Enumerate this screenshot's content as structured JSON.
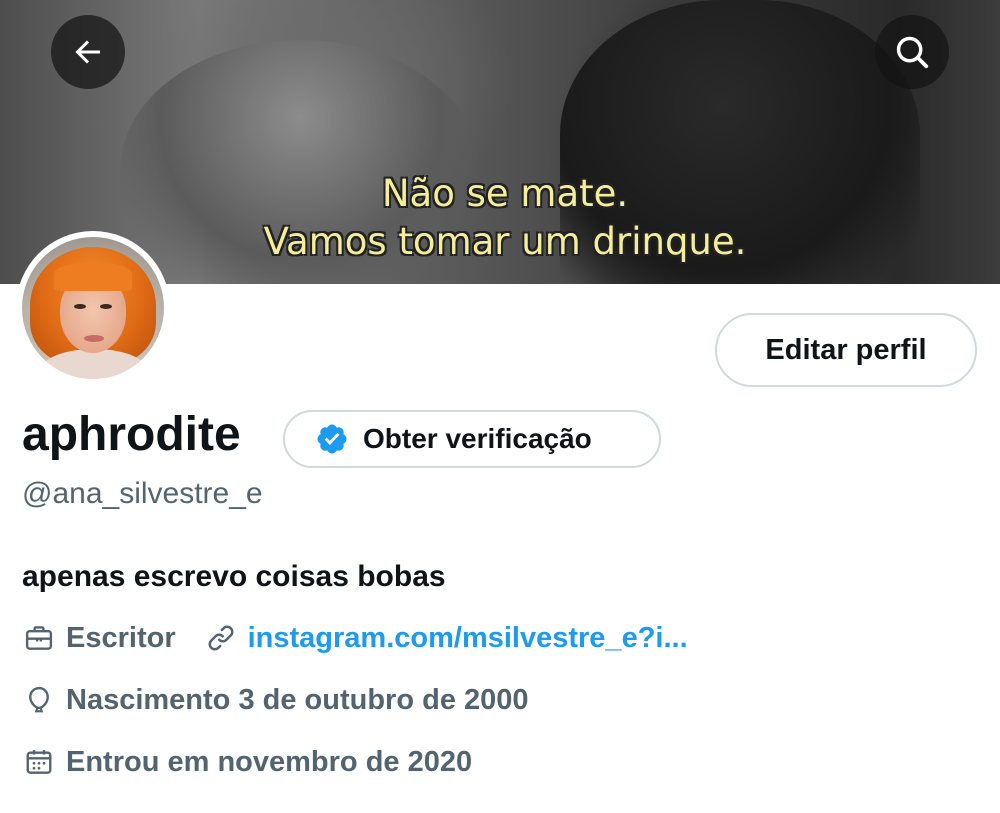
{
  "banner": {
    "subtitle_line1": "Não se mate.",
    "subtitle_line2": "Vamos tomar um drinque."
  },
  "nav": {
    "back_icon": "arrow-left-icon",
    "search_icon": "search-icon"
  },
  "profile": {
    "edit_button_label": "Editar perfil",
    "display_name": "aphrodite",
    "verification_label": "Obter verificação",
    "handle": "@ana_silvestre_e",
    "bio": "apenas escrevo coisas bobas",
    "profession": "Escritor",
    "website": "instagram.com/msilvestre_e?i...",
    "birthday": "Nascimento 3 de outubro de 2000",
    "joined": "Entrou em novembro de 2020"
  },
  "colors": {
    "text_primary": "#0f1419",
    "text_secondary": "#536471",
    "link": "#1d9bf0",
    "border": "#cfd9de",
    "subtitle": "#f4ee9a"
  }
}
